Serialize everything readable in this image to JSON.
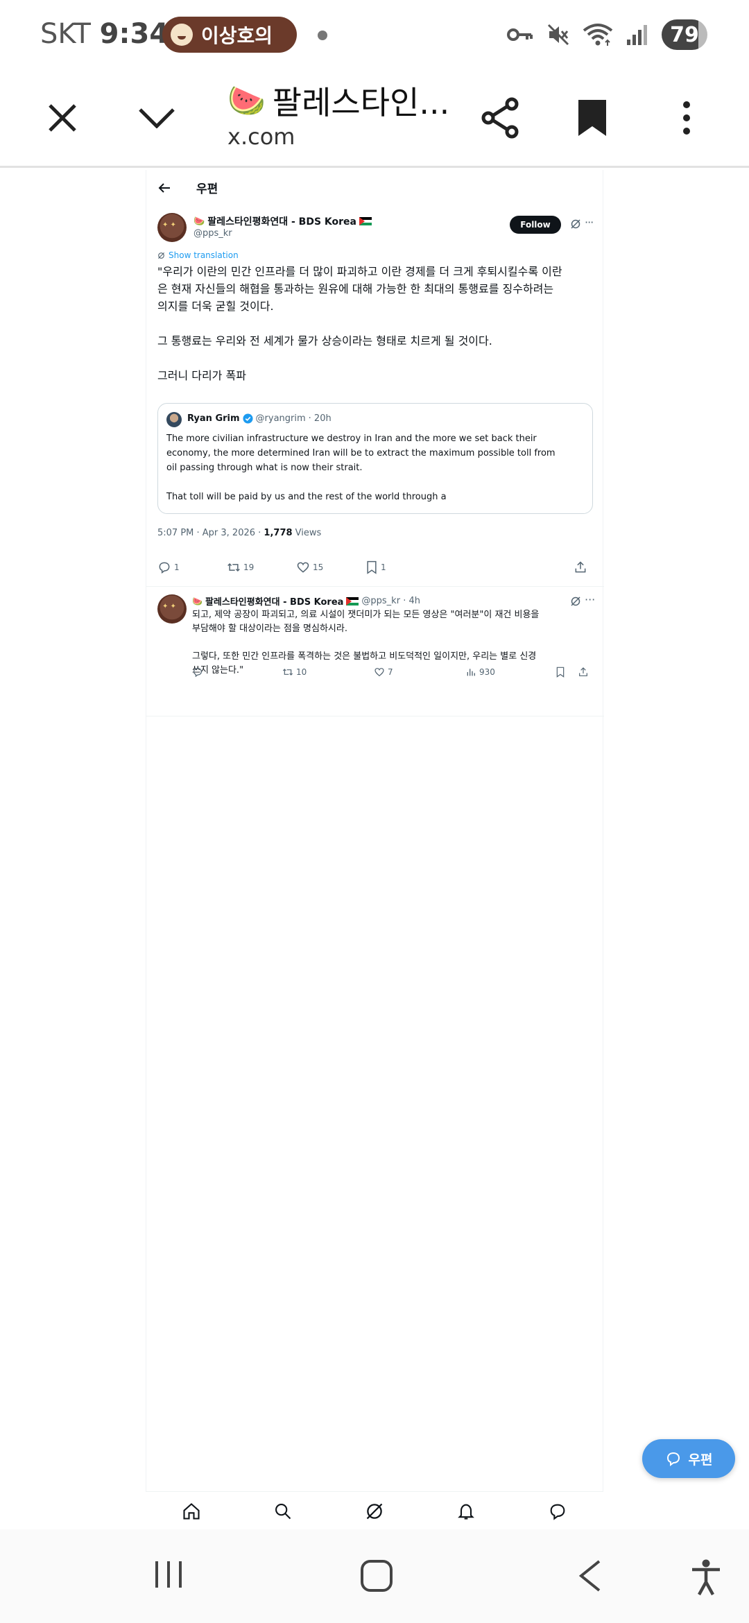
{
  "status_bar": {
    "carrier": "SKT",
    "time": "9:34",
    "notification_pill": "이상호의",
    "battery": "79"
  },
  "browser": {
    "page_title": "팔레스타인...",
    "url": "x.com"
  },
  "header": {
    "title": "우편"
  },
  "tweet": {
    "author_name": "팔레스타인평화연대 - BDS Korea",
    "handle": "@pps_kr",
    "follow_label": "Follow",
    "translate_label": "Show translation",
    "text": "\"우리가 이란의 민간 인프라를 더 많이 파괴하고 이란 경제를 더 크게 후퇴시킬수록 이란\n은 현재 자신들의 해협을 통과하는 원유에 대해 가능한 한 최대의 통행료를 징수하려는\n의지를 더욱 굳힐 것이다.\n\n그 통행료는 우리와 전 세계가 물가 상승이라는 형태로 치르게 될 것이다.\n\n그러니 다리가 폭파",
    "quote": {
      "author": "Ryan Grim",
      "handle": "@ryangrim",
      "time": "· 20h",
      "text": "The more civilian infrastructure we destroy in Iran and the more we set back their\neconomy, the more determined Iran will be to extract the maximum possible toll from\noil passing through what is now their strait.\n\nThat toll will be paid by us and the rest of the world through a"
    },
    "timestamp": "5:07 PM · Apr 3, 2026 · ",
    "views_count": "1,778",
    "views_label": " Views",
    "replies": "1",
    "reposts": "19",
    "likes": "15",
    "bookmarks": "1"
  },
  "reply": {
    "author_name": "팔레스타인평화연대 - BDS Korea",
    "handle_time": "@pps_kr · 4h",
    "text": "되고, 제약 공장이 파괴되고, 의료 시설이 잿더미가 되는 모든 영상은 \"여러분\"이 재건 비용을\n부담해야 할 대상이라는 점을 명심하시라.\n\n그렇다, 또한 민간 인프라를 폭격하는 것은 불법하고 비도덕적인 일이지만, 우리는 별로 신경\n쓰지 않는다.\"",
    "reposts": "10",
    "likes": "7",
    "views": "930"
  },
  "fab": {
    "label": "우편"
  },
  "colors": {
    "accent": "#1d9bf0",
    "fab": "#4a99e9",
    "pill": "#6b3a2a",
    "text": "#0f1419",
    "muted": "#536471"
  }
}
